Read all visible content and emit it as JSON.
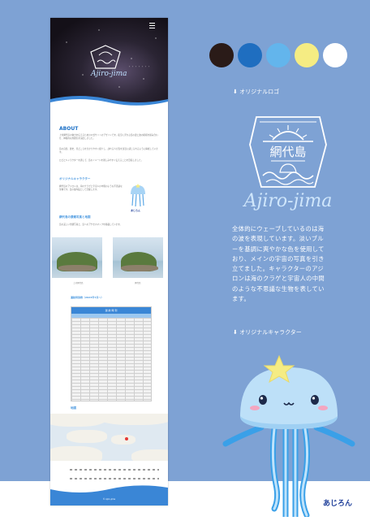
{
  "mockup": {
    "about_title": "ABOUT",
    "about_paragraphs": [
      "上対網代島の魅力を伝えるための公式サイトのデザインです。夜空に浮かぶ島の姿と波の模様を組み合わせ、神秘的な雰囲気を演出しました。",
      "島の自然、歴史、見どころを分かりやすく紹介し、訪れる人が島を身近に感じられるように構成しています。",
      "ロゴとキャラクターを通して、島のイメージを親しみやすく伝えることを目指しました。"
    ],
    "character_title": "オリジナルキャラクター",
    "character_paragraph": "網代島のアジロンは、海のクラゲと宇宙人の中間のような不思議な生物です。島の案内役として活躍します。",
    "character_caption": "あじろん",
    "photos_title": "網代島の景観写真と地図",
    "photos_paragraph": "島の美しい景観写真と、島へのアクセスマップを掲載しています。",
    "photo_captions": [
      "上対網代島",
      "網代島"
    ],
    "table_title": "運航時刻表（2023年7月〜）",
    "table_header": "運 航 時 刻",
    "map_title": "地図",
    "footer_text": "© Ajiro-jima"
  },
  "colors": {
    "palette": [
      "#2a1b18",
      "#1f6ec0",
      "#63b5ec",
      "#f5ec83",
      "#ffffff"
    ],
    "background": "#7ea2d4"
  },
  "logo_label": "⬇ オリジナルロゴ",
  "logo": {
    "kanji": "網代島",
    "script": "Ajiro-jima"
  },
  "description": "全体的にウェーブしているのは海の波を表現しています。淡いブルーを基調に爽やかな色を使用しており、メインの宇宙の写真を引き立てました。キャラクターのアジロンは海のクラゲと宇宙人の中間のような不思議な生物を表しています。",
  "character_label": "⬇ オリジナルキャラクター",
  "character_name": "あじろん"
}
